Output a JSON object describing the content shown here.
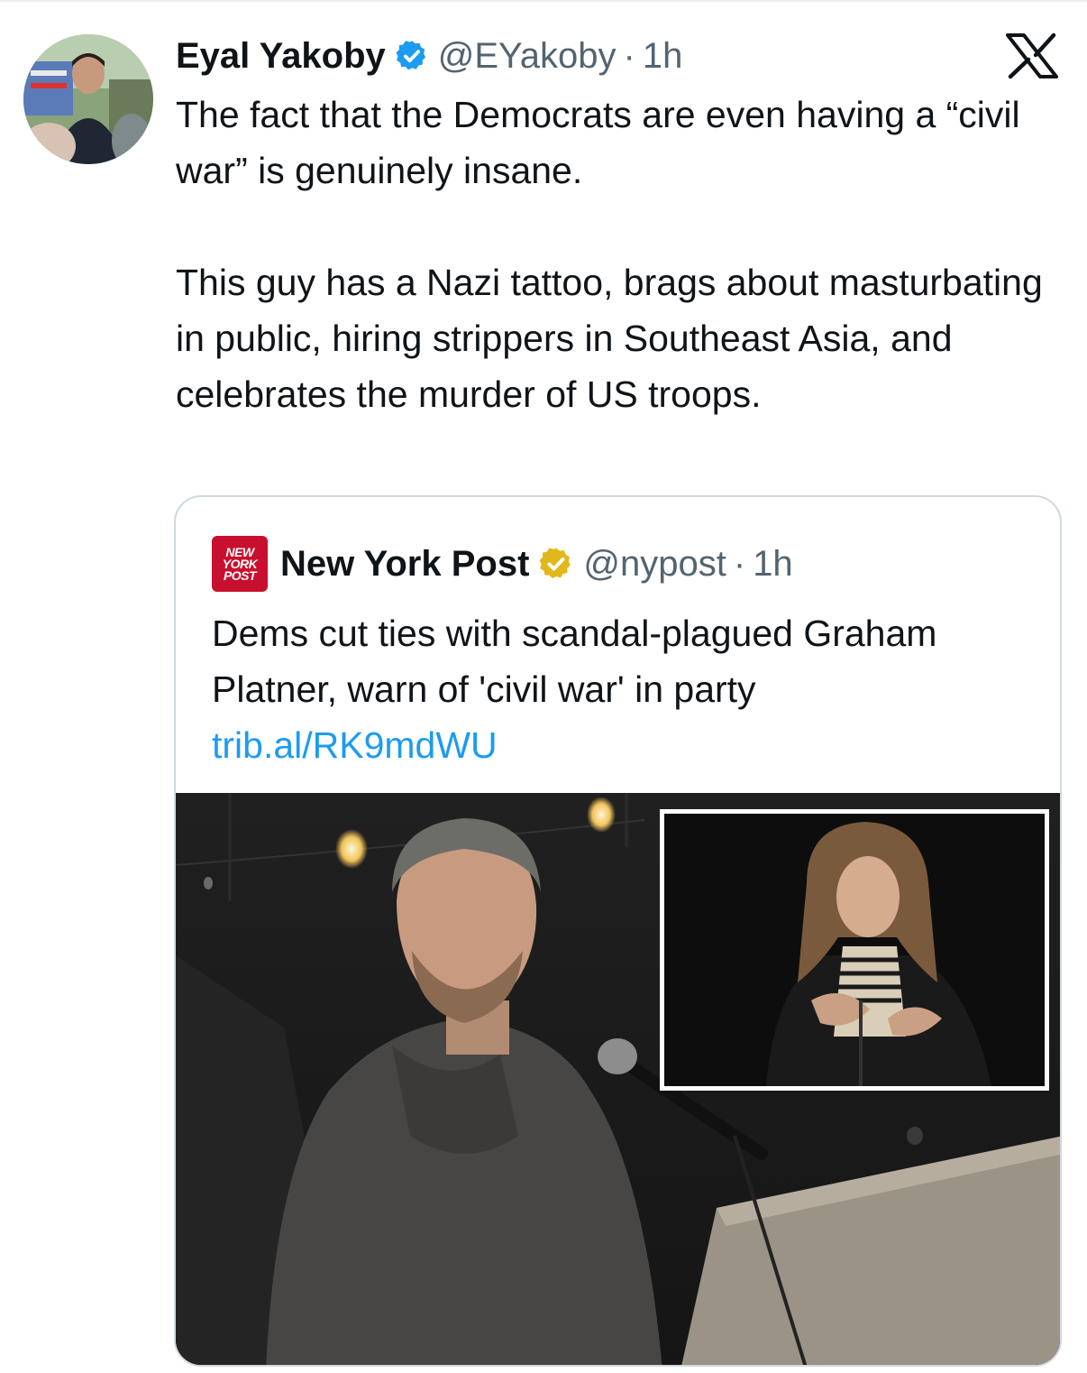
{
  "tweet": {
    "author_name": "Eyal Yakoby",
    "handle": "@EYakoby",
    "separator": "·",
    "time": "1h",
    "text": "The fact that the Democrats are even having a “civil war” is genuinely insane.\n\nThis guy has a Nazi tattoo, brags about masturbating in public, hiring strippers in Southeast Asia, and celebrates the murder of US troops."
  },
  "quote": {
    "logo_text": [
      "NEW",
      "YORK",
      "POST"
    ],
    "author_name": "New York Post",
    "handle": "@nypost",
    "separator": "·",
    "time": "1h",
    "text": "Dems cut ties with scandal-plagued Graham Platner, warn of 'civil war' in party",
    "link": "trib.al/RK9mdWU"
  },
  "icons": {
    "verified_badge": "blue-check-icon",
    "quote_verified_badge": "gold-check-icon",
    "platform_logo": "x-logo-icon"
  },
  "colors": {
    "text_primary": "#0f1419",
    "text_secondary": "#536471",
    "link": "#1d9bf0",
    "verified_blue": "#1d9bf0",
    "verified_gold": "#e2b719",
    "nypost_red": "#c8102e",
    "border": "#cfd9de"
  }
}
